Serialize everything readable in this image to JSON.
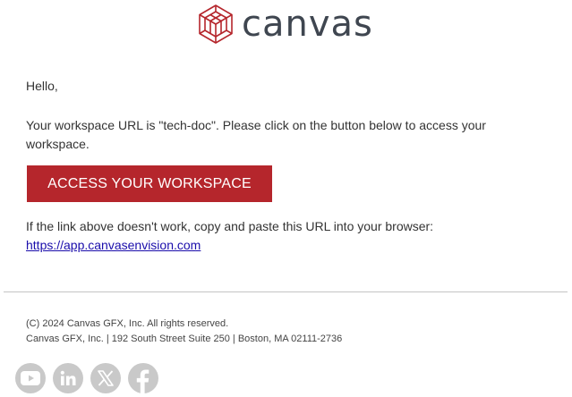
{
  "logo": {
    "text": "canvas",
    "icon": "canvas-cube-logo-icon",
    "brand_color": "#b5262c"
  },
  "email": {
    "greeting": "Hello,",
    "body": "Your workspace URL is \"tech-doc\". Please click on the button below to access your workspace.",
    "cta_label": "ACCESS YOUR WORKSPACE",
    "fallback_text": "If the link above doesn't work, copy and paste this URL into your browser:",
    "url": "https://app.canvasenvision.com"
  },
  "footer": {
    "copyright": "(C) 2024 Canvas GFX, Inc. All rights reserved.",
    "address": "Canvas GFX, Inc. | 192 South Street Suite 250 | Boston, MA 02111-2736",
    "social": [
      {
        "name": "youtube-icon"
      },
      {
        "name": "linkedin-icon"
      },
      {
        "name": "x-twitter-icon"
      },
      {
        "name": "facebook-icon"
      }
    ]
  }
}
